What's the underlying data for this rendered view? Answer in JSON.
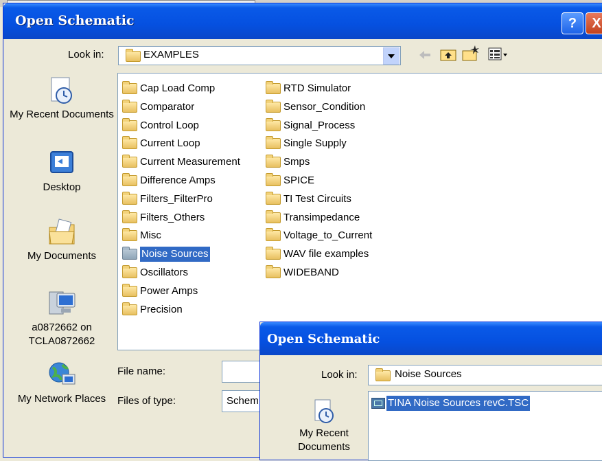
{
  "dialog": {
    "title": "Open Schematic",
    "help_label": "?",
    "close_label": "X",
    "look_in_label": "Look in:",
    "look_in_value": "EXAMPLES",
    "file_name_label": "File name:",
    "file_name_value": "",
    "files_of_type_label": "Files of type:",
    "files_of_type_value": "Schem"
  },
  "places": [
    {
      "label": "My Recent Documents",
      "icon": "recent-documents-icon"
    },
    {
      "label": "Desktop",
      "icon": "desktop-icon"
    },
    {
      "label": "My Documents",
      "icon": "my-documents-icon"
    },
    {
      "label": "a0872662 on TCLA0872662",
      "icon": "my-computer-icon"
    },
    {
      "label": "My Network Places",
      "icon": "network-places-icon"
    }
  ],
  "folders_col1": [
    "Cap Load Comp",
    "Comparator",
    "Control Loop",
    "Current Loop",
    "Current Measurement",
    "Difference Amps",
    "Filters_FilterPro",
    "Filters_Others",
    "Misc",
    "Noise Sources",
    "Oscillators",
    "Power Amps",
    "Precision"
  ],
  "folders_col2": [
    "RTD Simulator",
    "Sensor_Condition",
    "Signal_Process",
    "Single Supply",
    "Smps",
    "SPICE",
    "TI Test Circuits",
    "Transimpedance",
    "Voltage_to_Current",
    "WAV file examples",
    "WIDEBAND"
  ],
  "selected_folder": "Noise Sources",
  "dialog2": {
    "title": "Open Schematic",
    "look_in_label": "Look in:",
    "look_in_value": "Noise Sources",
    "file": "TINA Noise Sources revC.TSC",
    "recent_label": "My Recent",
    "recent_label2": "Documents"
  },
  "colors": {
    "titlebar": "#0550E0",
    "selection": "#316AC5",
    "dialog_bg": "#ECE9D8"
  }
}
